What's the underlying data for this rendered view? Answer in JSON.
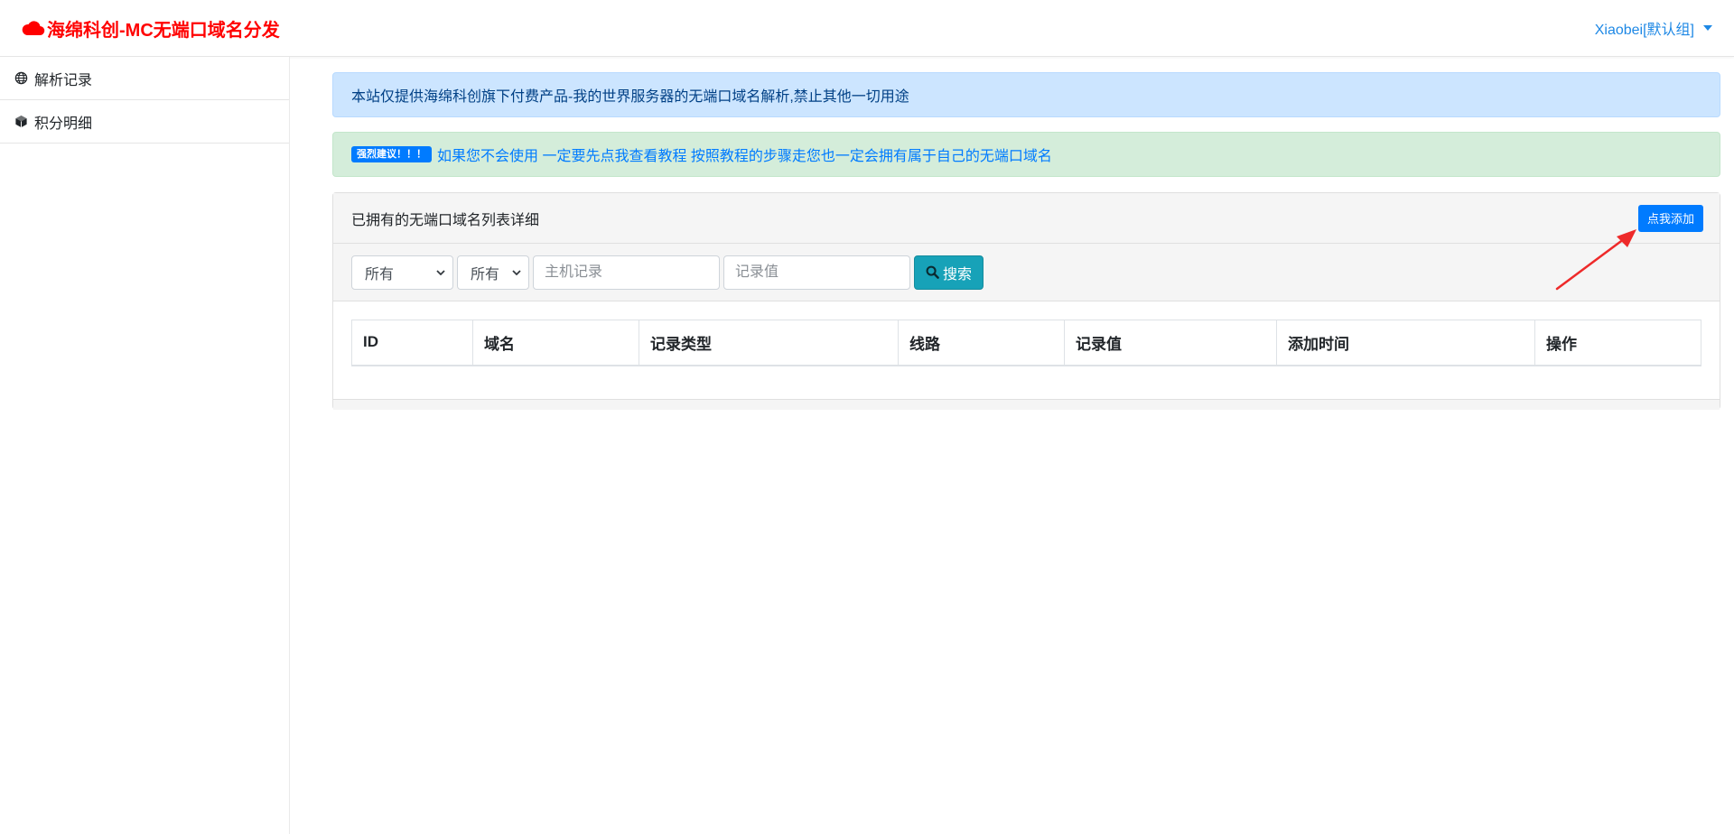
{
  "navbar": {
    "brand": "海绵科创-MC无端口域名分发",
    "user_label": "Xiaobei[默认组]"
  },
  "sidebar": {
    "items": [
      {
        "label": "解析记录",
        "icon": "globe-icon"
      },
      {
        "label": "积分明细",
        "icon": "cube-icon"
      }
    ]
  },
  "alerts": {
    "info_text": "本站仅提供海绵科创旗下付费产品-我的世界服务器的无端口域名解析,禁止其他一切用途",
    "success_badge": "强烈建议！！！",
    "success_link": "如果您不会使用 一定要先点我查看教程 按照教程的步骤走您也一定会拥有属于自己的无端口域名"
  },
  "card": {
    "title": "已拥有的无端口域名列表详细",
    "add_button": "点我添加",
    "filters": {
      "select1_value": "所有",
      "select2_value": "所有",
      "host_placeholder": "主机记录",
      "value_placeholder": "记录值",
      "search_label": "搜索"
    },
    "table": {
      "columns": [
        "ID",
        "域名",
        "记录类型",
        "线路",
        "记录值",
        "添加时间",
        "操作"
      ]
    }
  },
  "colors": {
    "brand": "#ff0000",
    "primary": "#007bff",
    "info_button": "#17a2b8",
    "annotation_arrow": "#ee2a2a"
  }
}
